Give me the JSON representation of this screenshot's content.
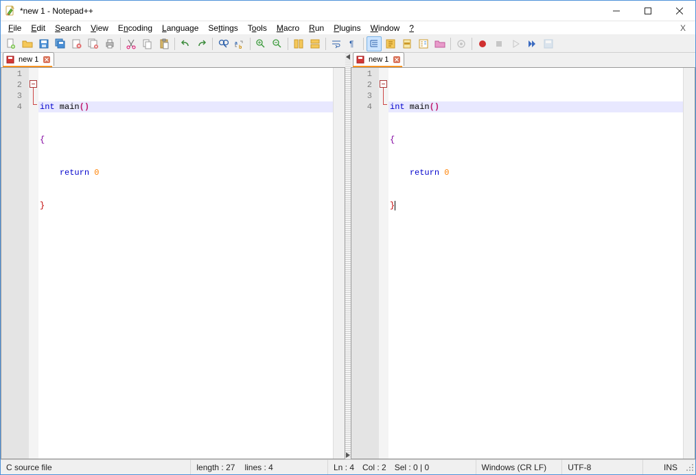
{
  "window": {
    "title": "*new 1 - Notepad++"
  },
  "menu": {
    "file": "File",
    "edit": "Edit",
    "search": "Search",
    "view": "View",
    "encoding": "Encoding",
    "language": "Language",
    "settings": "Settings",
    "tools": "Tools",
    "macro": "Macro",
    "run": "Run",
    "plugins": "Plugins",
    "window": "Window",
    "help": "?"
  },
  "toolbar_icons": [
    "new-file",
    "open-file",
    "save",
    "save-all",
    "close",
    "close-all",
    "print",
    "|",
    "cut",
    "copy",
    "paste",
    "|",
    "undo",
    "redo",
    "|",
    "find",
    "replace",
    "|",
    "zoom-in",
    "zoom-out",
    "|",
    "sync-v",
    "sync-h",
    "|",
    "wrap",
    "show-all",
    "|",
    "indent-guide",
    "lang-pref",
    "doc-map",
    "func-list",
    "folder-workspace",
    "|",
    "monitor",
    "|",
    "record",
    "stop",
    "play",
    "play-multi",
    "save-macro"
  ],
  "tabs": {
    "left": {
      "label": "new 1"
    },
    "right": {
      "label": "new 1"
    }
  },
  "editor": {
    "line_numbers": [
      "1",
      "2",
      "3",
      "4"
    ],
    "code": {
      "l1_kw": "int",
      "l1_id": " main",
      "l1_paren": "()",
      "l2_brace": "{",
      "l3_kw": "return",
      "l3_num": " 0",
      "l4_brace": "}"
    }
  },
  "status": {
    "filetype": "C source file",
    "length_label": "length : 27",
    "lines_label": "lines : 4",
    "ln": "Ln : 4",
    "col": "Col : 2",
    "sel": "Sel : 0 | 0",
    "eol": "Windows (CR LF)",
    "encoding": "UTF-8",
    "ins": "INS"
  }
}
